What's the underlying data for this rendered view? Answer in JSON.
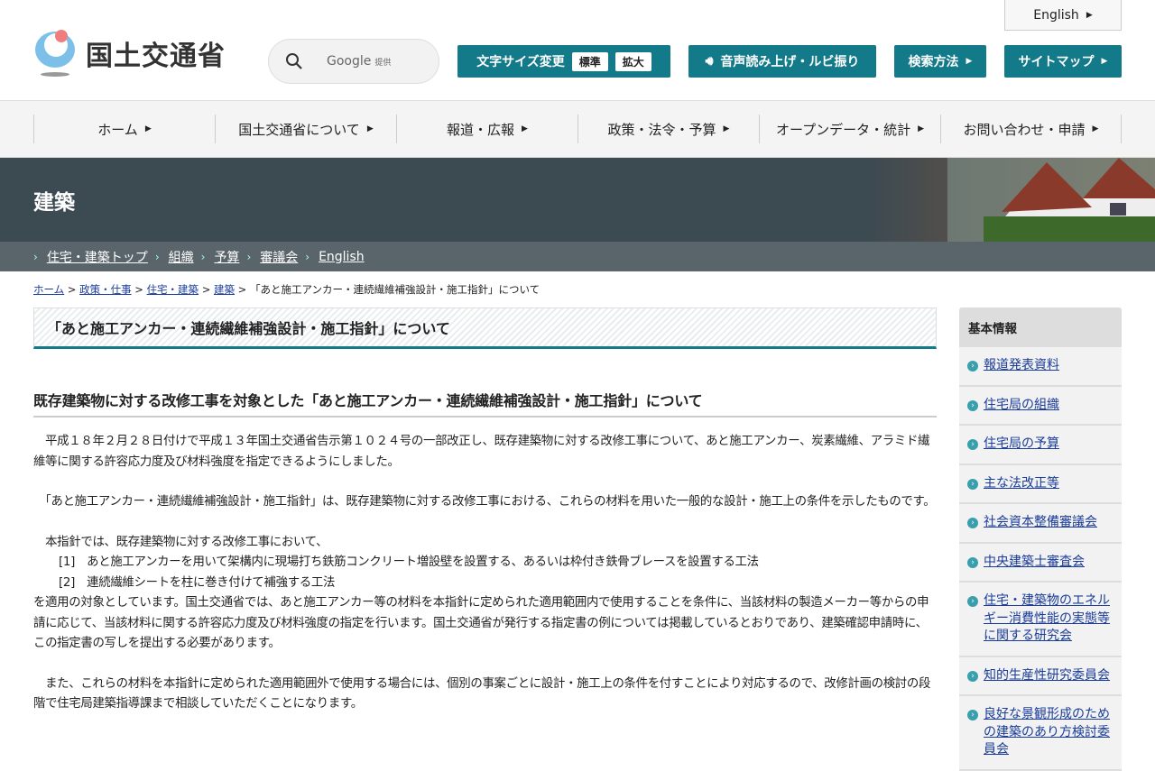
{
  "header": {
    "logo_text": "国土交通省",
    "search_brand": "Google",
    "search_suffix": "提供",
    "font_size_label": "文字サイズ変更",
    "font_standard": "標準",
    "font_large": "拡大",
    "voice_label": "音声読み上げ・ルビ振り",
    "search_method": "検索方法",
    "sitemap": "サイトマップ",
    "english": "English"
  },
  "nav": [
    "ホーム",
    "国土交通省について",
    "報道・広報",
    "政策・法令・予算",
    "オープンデータ・統計",
    "お問い合わせ・申請"
  ],
  "banner": {
    "title": "建築"
  },
  "subnav": [
    "住宅・建築トップ",
    "組織",
    "予算",
    "審議会",
    "English"
  ],
  "breadcrumb": {
    "links": [
      "ホーム",
      "政策・仕事",
      "住宅・建築",
      "建築"
    ],
    "current": "「あと施工アンカー・連続繊維補強設計・施工指針」について"
  },
  "main": {
    "title": "「あと施工アンカー・連続繊維補強設計・施工指針」について",
    "heading": "既存建築物に対する改修工事を対象とした「あと施工アンカー・連続繊維補強設計・施工指針」について",
    "p1": "　平成１８年２月２８日付けで平成１３年国土交通省告示第１０２４号の一部改正し、既存建築物に対する改修工事について、あと施工アンカー、炭素繊維、アラミド繊維等に関する許容応力度及び材料強度を指定できるようにしました。",
    "p2": "　「あと施工アンカー・連続繊維補強設計・施工指針」は、既存建築物に対する改修工事における、これらの材料を用いた一般的な設計・施工上の条件を示したものです。",
    "p3": "　本指針では、既存建築物に対する改修工事において、",
    "item1": "[1]　あと施工アンカーを用いて架構内に現場打ち鉄筋コンクリート増設壁を設置する、あるいは枠付き鉄骨ブレースを設置する工法",
    "item2": "[2]　連続繊維シートを柱に巻き付けて補強する工法",
    "p4": "を適用の対象としています。国土交通省では、あと施工アンカー等の材料を本指針に定められた適用範囲内で使用することを条件に、当該材料の製造メーカー等からの申請に応じて、当該材料に関する許容応力度及び材料強度の指定を行います。国土交通省が発行する指定書の例については掲載しているとおりであり、建築確認申請時に、この指定書の写しを提出する必要があります。",
    "p5": "　また、これらの材料を本指針に定められた適用範囲外で使用する場合には、個別の事案ごとに設計・施工上の条件を付すことにより対応するので、改修計画の検討の段階で住宅局建築指導課まで相談していただくことになります。"
  },
  "sidebar": {
    "heading": "基本情報",
    "items": [
      "報道発表資料",
      "住宅局の組織",
      "住宅局の予算",
      "主な法改正等",
      "社会資本整備審議会",
      "中央建築士審査会",
      "住宅・建築物のエネルギー消費性能の実態等に関する研究会",
      "知的生産性研究委員会",
      "良好な景観形成のための建築のあり方検討委員会"
    ]
  }
}
